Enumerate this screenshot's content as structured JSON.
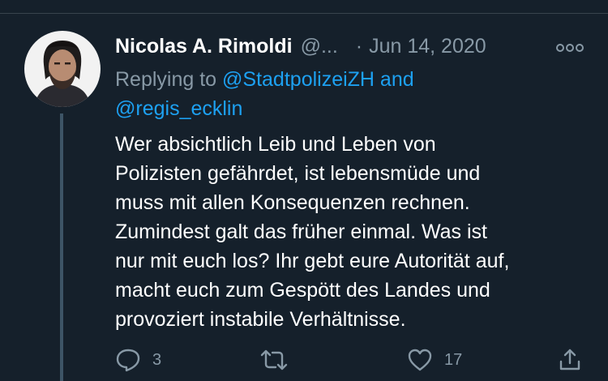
{
  "tweet": {
    "author_name": "Nicolas A. Rimoldi",
    "handle": "@...",
    "separator": "·",
    "date": "Jun 14, 2020",
    "replying_label": "Replying to ",
    "mentions": [
      "@StadtpolizeiZH",
      "@regis_ecklin"
    ],
    "mention_joiner": " and",
    "text_lines": [
      "Wer absichtlich Leib und Leben von",
      "Polizisten gefährdet, ist lebensmüde und",
      "muss mit allen Konsequenzen rechnen.",
      "Zumindest galt das früher einmal. Was ist",
      "nur mit euch los? Ihr gebt eure Autorität auf,",
      "macht euch zum Gespött des Landes und",
      "provoziert instabile Verhältnisse."
    ]
  },
  "actions": {
    "reply_count": "3",
    "retweet_count": "",
    "like_count": "17"
  },
  "icons": {
    "more": "more-horizontal-icon",
    "reply": "reply-icon",
    "retweet": "retweet-icon",
    "like": "heart-icon",
    "share": "share-icon"
  },
  "colors": {
    "background": "#15202b",
    "text": "#ffffff",
    "secondary": "#8899a6",
    "accent": "#1da1f2",
    "thread_line": "#3d5466"
  }
}
